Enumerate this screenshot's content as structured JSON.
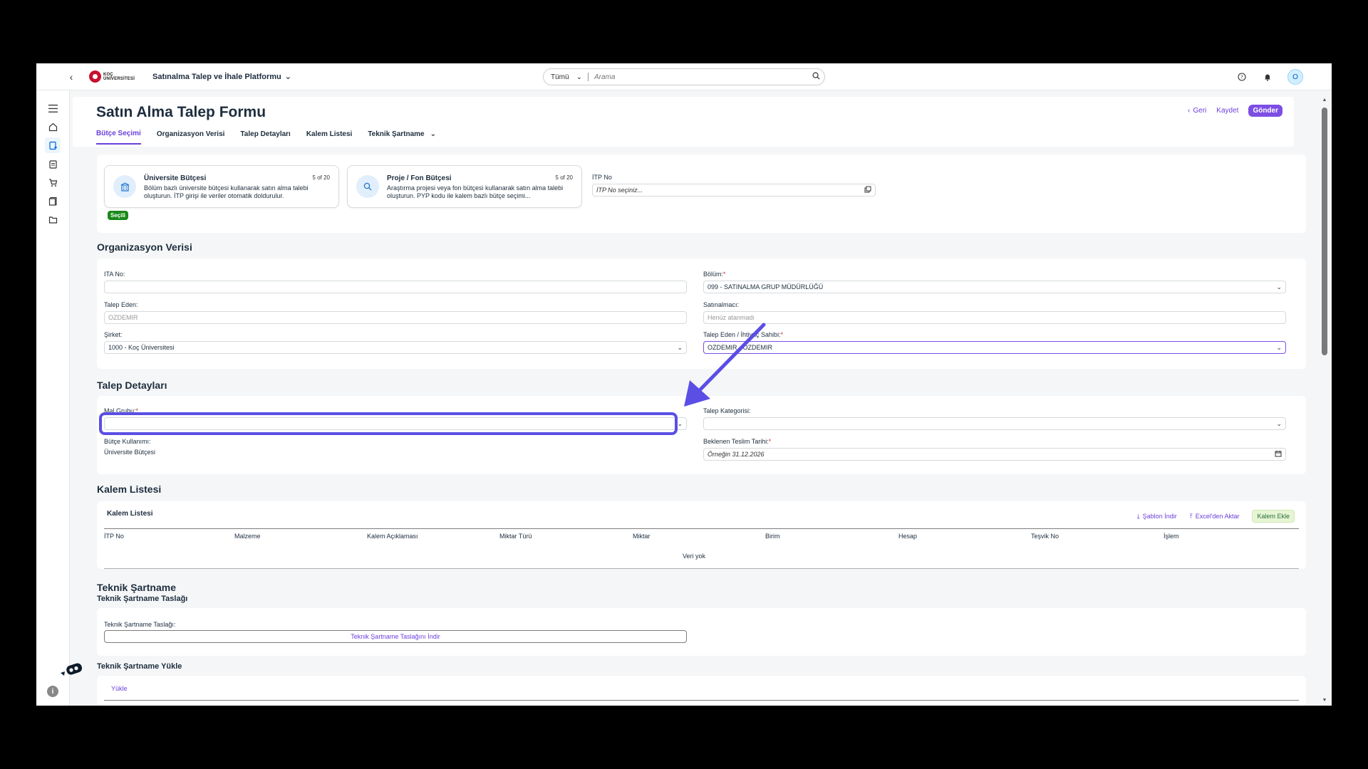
{
  "shell": {
    "logo_line1": "KOÇ",
    "logo_line2": "ÜNİVERSİTESİ",
    "platform_title": "Satınalma Talep ve İhale Platformu",
    "search_scope": "Tümü",
    "search_placeholder": "Arama",
    "avatar_initial": "O"
  },
  "header": {
    "title": "Satın Alma Talep Formu",
    "back_label": "Geri",
    "save_label": "Kaydet",
    "send_label": "Gönder",
    "tabs": [
      {
        "label": "Bütçe Seçimi"
      },
      {
        "label": "Organizasyon Verisi"
      },
      {
        "label": "Talep Detayları"
      },
      {
        "label": "Kalem Listesi"
      },
      {
        "label": "Teknik Şartname"
      }
    ]
  },
  "budget": {
    "tiles": [
      {
        "title": "Üniversite Bütçesi",
        "count": "5 of 20",
        "desc": "Bölüm bazlı üniversite bütçesi kullanarak satın alma talebi oluşturun. İTP girişi ile veriler otomatik doldurulur."
      },
      {
        "title": "Proje / Fon Bütçesi",
        "count": "5 of 20",
        "desc": "Araştırma projesi veya fon bütçesi kullanarak satın alma talebi oluşturun. PYP kodu ile kalem bazlı bütçe seçimi..."
      }
    ],
    "selected_badge": "Seçili",
    "itp_label": "İTP No",
    "itp_placeholder": "İTP No seçiniz..."
  },
  "org": {
    "title": "Organizasyon Verisi",
    "ita_label": "ITA No:",
    "talep_eden_label": "Talep Eden:",
    "talep_eden_value": "OZDEMIR",
    "sirket_label": "Şirket:",
    "sirket_value": "1000 - Koç Üniversitesi",
    "bolum_label": "Bölüm:",
    "bolum_value": "099 - SATINALMA GRUP MÜDÜRLÜĞÜ",
    "satinalmaci_label": "Satınalmacı:",
    "satinalmaci_value": "Henüz atanmadı",
    "ihtiyac_label": "Talep Eden / İhtiyaç Sahibi:",
    "ihtiyac_value": "OZDEMIR - OZDEMIR"
  },
  "details": {
    "title": "Talep Detayları",
    "mal_grubu_label": "Mal Grubu:",
    "kategori_label": "Talep Kategorisi:",
    "butce_kullanimi_label": "Bütçe Kullanımı:",
    "butce_kullanimi_value": "Üniversite Bütçesi",
    "teslim_label": "Beklenen Teslim Tarihi:",
    "teslim_placeholder": "Örneğin 31.12.2026"
  },
  "items": {
    "title": "Kalem Listesi",
    "card_title": "Kalem Listesi",
    "template_download": "Şablon İndir",
    "excel_import": "Excel'den Aktar",
    "add_item": "Kalem Ekle",
    "columns": [
      "İTP No",
      "Malzeme",
      "Kalem Açıklaması",
      "Miktar Türü",
      "Miktar",
      "Birim",
      "Hesap",
      "Teşvik No",
      "İşlem"
    ],
    "no_data": "Veri yok"
  },
  "spec": {
    "title": "Teknik Şartname",
    "draft_subtitle": "Teknik Şartname Taslağı",
    "draft_label": "Teknik Şartname Taslağı:",
    "draft_download": "Teknik Şartname Taslağını İndir",
    "upload_subtitle": "Teknik Şartname Yükle",
    "upload_link": "Yükle"
  },
  "colors": {
    "accent": "#7c4ee4",
    "annotation": "#5b4ee5",
    "selected": "#188918"
  }
}
